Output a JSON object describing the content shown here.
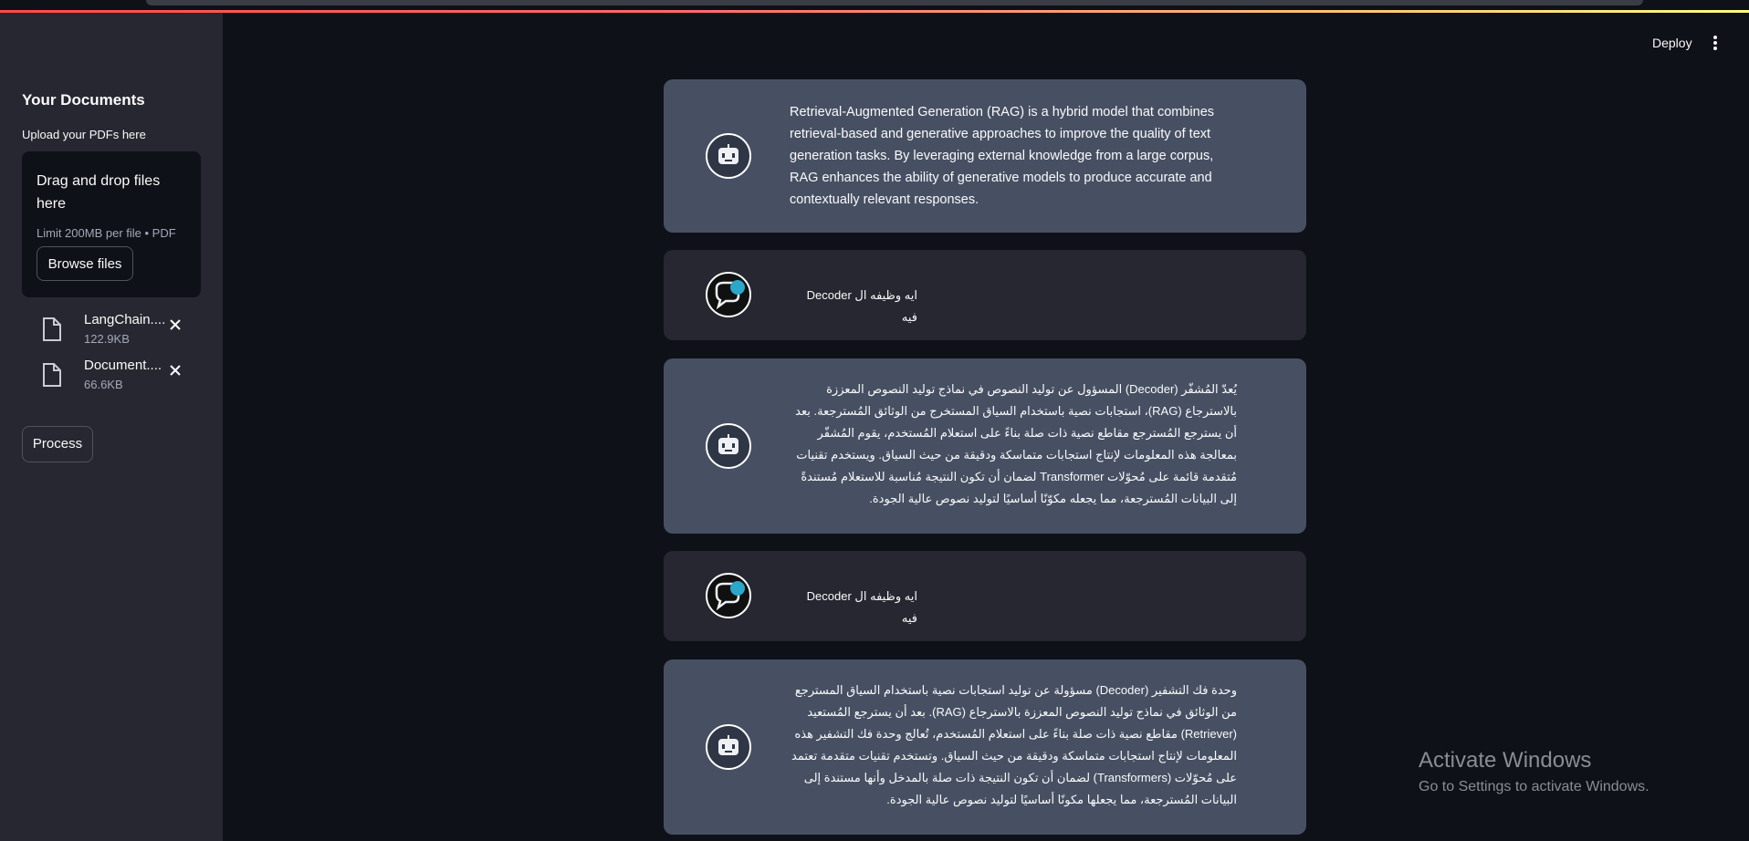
{
  "topbar": {
    "deploy_label": "Deploy",
    "accent_gradient": [
      "#ff4b4b",
      "#fffd80"
    ]
  },
  "sidebar": {
    "title": "Your Documents",
    "upload_label": "Upload your PDFs here",
    "dropzone": {
      "title": "Drag and drop files here",
      "limit": "Limit 200MB per file • PDF",
      "browse_label": "Browse files"
    },
    "files": [
      {
        "name": "LangChain....",
        "size": "122.9KB",
        "icon": "file-icon"
      },
      {
        "name": "Document....",
        "size": "66.6KB",
        "icon": "file-icon"
      }
    ],
    "process_label": "Process"
  },
  "chat": {
    "messages": [
      {
        "role": "assistant",
        "avatar": "robot-icon",
        "text": "Retrieval-Augmented Generation (RAG) is a hybrid model that combines retrieval-based and generative approaches to improve the quality of text generation tasks. By leveraging external knowledge from a large corpus, RAG enhances the ability of generative models to produce accurate and contextually relevant responses."
      },
      {
        "role": "user",
        "avatar": "chat-bubble-icon",
        "text": "ايه وظيفه ال Decoder فيه"
      },
      {
        "role": "assistant",
        "avatar": "robot-icon",
        "text": "يُعدّ المُشفّر (Decoder) المسؤول عن توليد النصوص في نماذج توليد النصوص المعززة بالاسترجاع (RAG)، استجابات نصية باستخدام السياق المستخرج من الوثائق المُسترجعة. بعد أن يسترجع المُسترجع مقاطع نصية ذات صلة بناءً على استعلام المُستخدم، يقوم المُشفّر بمعالجة هذه المعلومات لإنتاج استجابات متماسكة ودقيقة من حيث السياق. ويستخدم تقنيات مُتقدمة قائمة على مُحوّلات Transformer لضمان أن تكون النتيجة مُناسبة للاستعلام مُستندةً إلى البيانات المُسترجعة، مما يجعله مكوّنًا أساسيًا لتوليد نصوص عالية الجودة."
      },
      {
        "role": "user",
        "avatar": "chat-bubble-icon",
        "text": "ايه وظيفه ال Decoder فيه"
      },
      {
        "role": "assistant",
        "avatar": "robot-icon",
        "text": "وحدة فك التشفير (Decoder) مسؤولة عن توليد استجابات نصية باستخدام السياق المسترجع من الوثائق في نماذج توليد النصوص المعززة بالاسترجاع (RAG). بعد أن يسترجع المُستعيد (Retriever) مقاطع نصية ذات صلة بناءً على استعلام المُستخدم، تُعالج وحدة فك التشفير هذه المعلومات لإنتاج استجابات متماسكة ودقيقة من حيث السياق. وتستخدم تقنيات متقدمة تعتمد على مُحوّلات (Transformers) لضمان أن تكون النتيجة ذات صلة بالمدخل وأنها مستندة إلى البيانات المُسترجعة، مما يجعلها مكونًا أساسيًا لتوليد نصوص عالية الجودة."
      }
    ]
  },
  "watermark": {
    "title": "Activate Windows",
    "subtitle": "Go to Settings to activate Windows."
  }
}
